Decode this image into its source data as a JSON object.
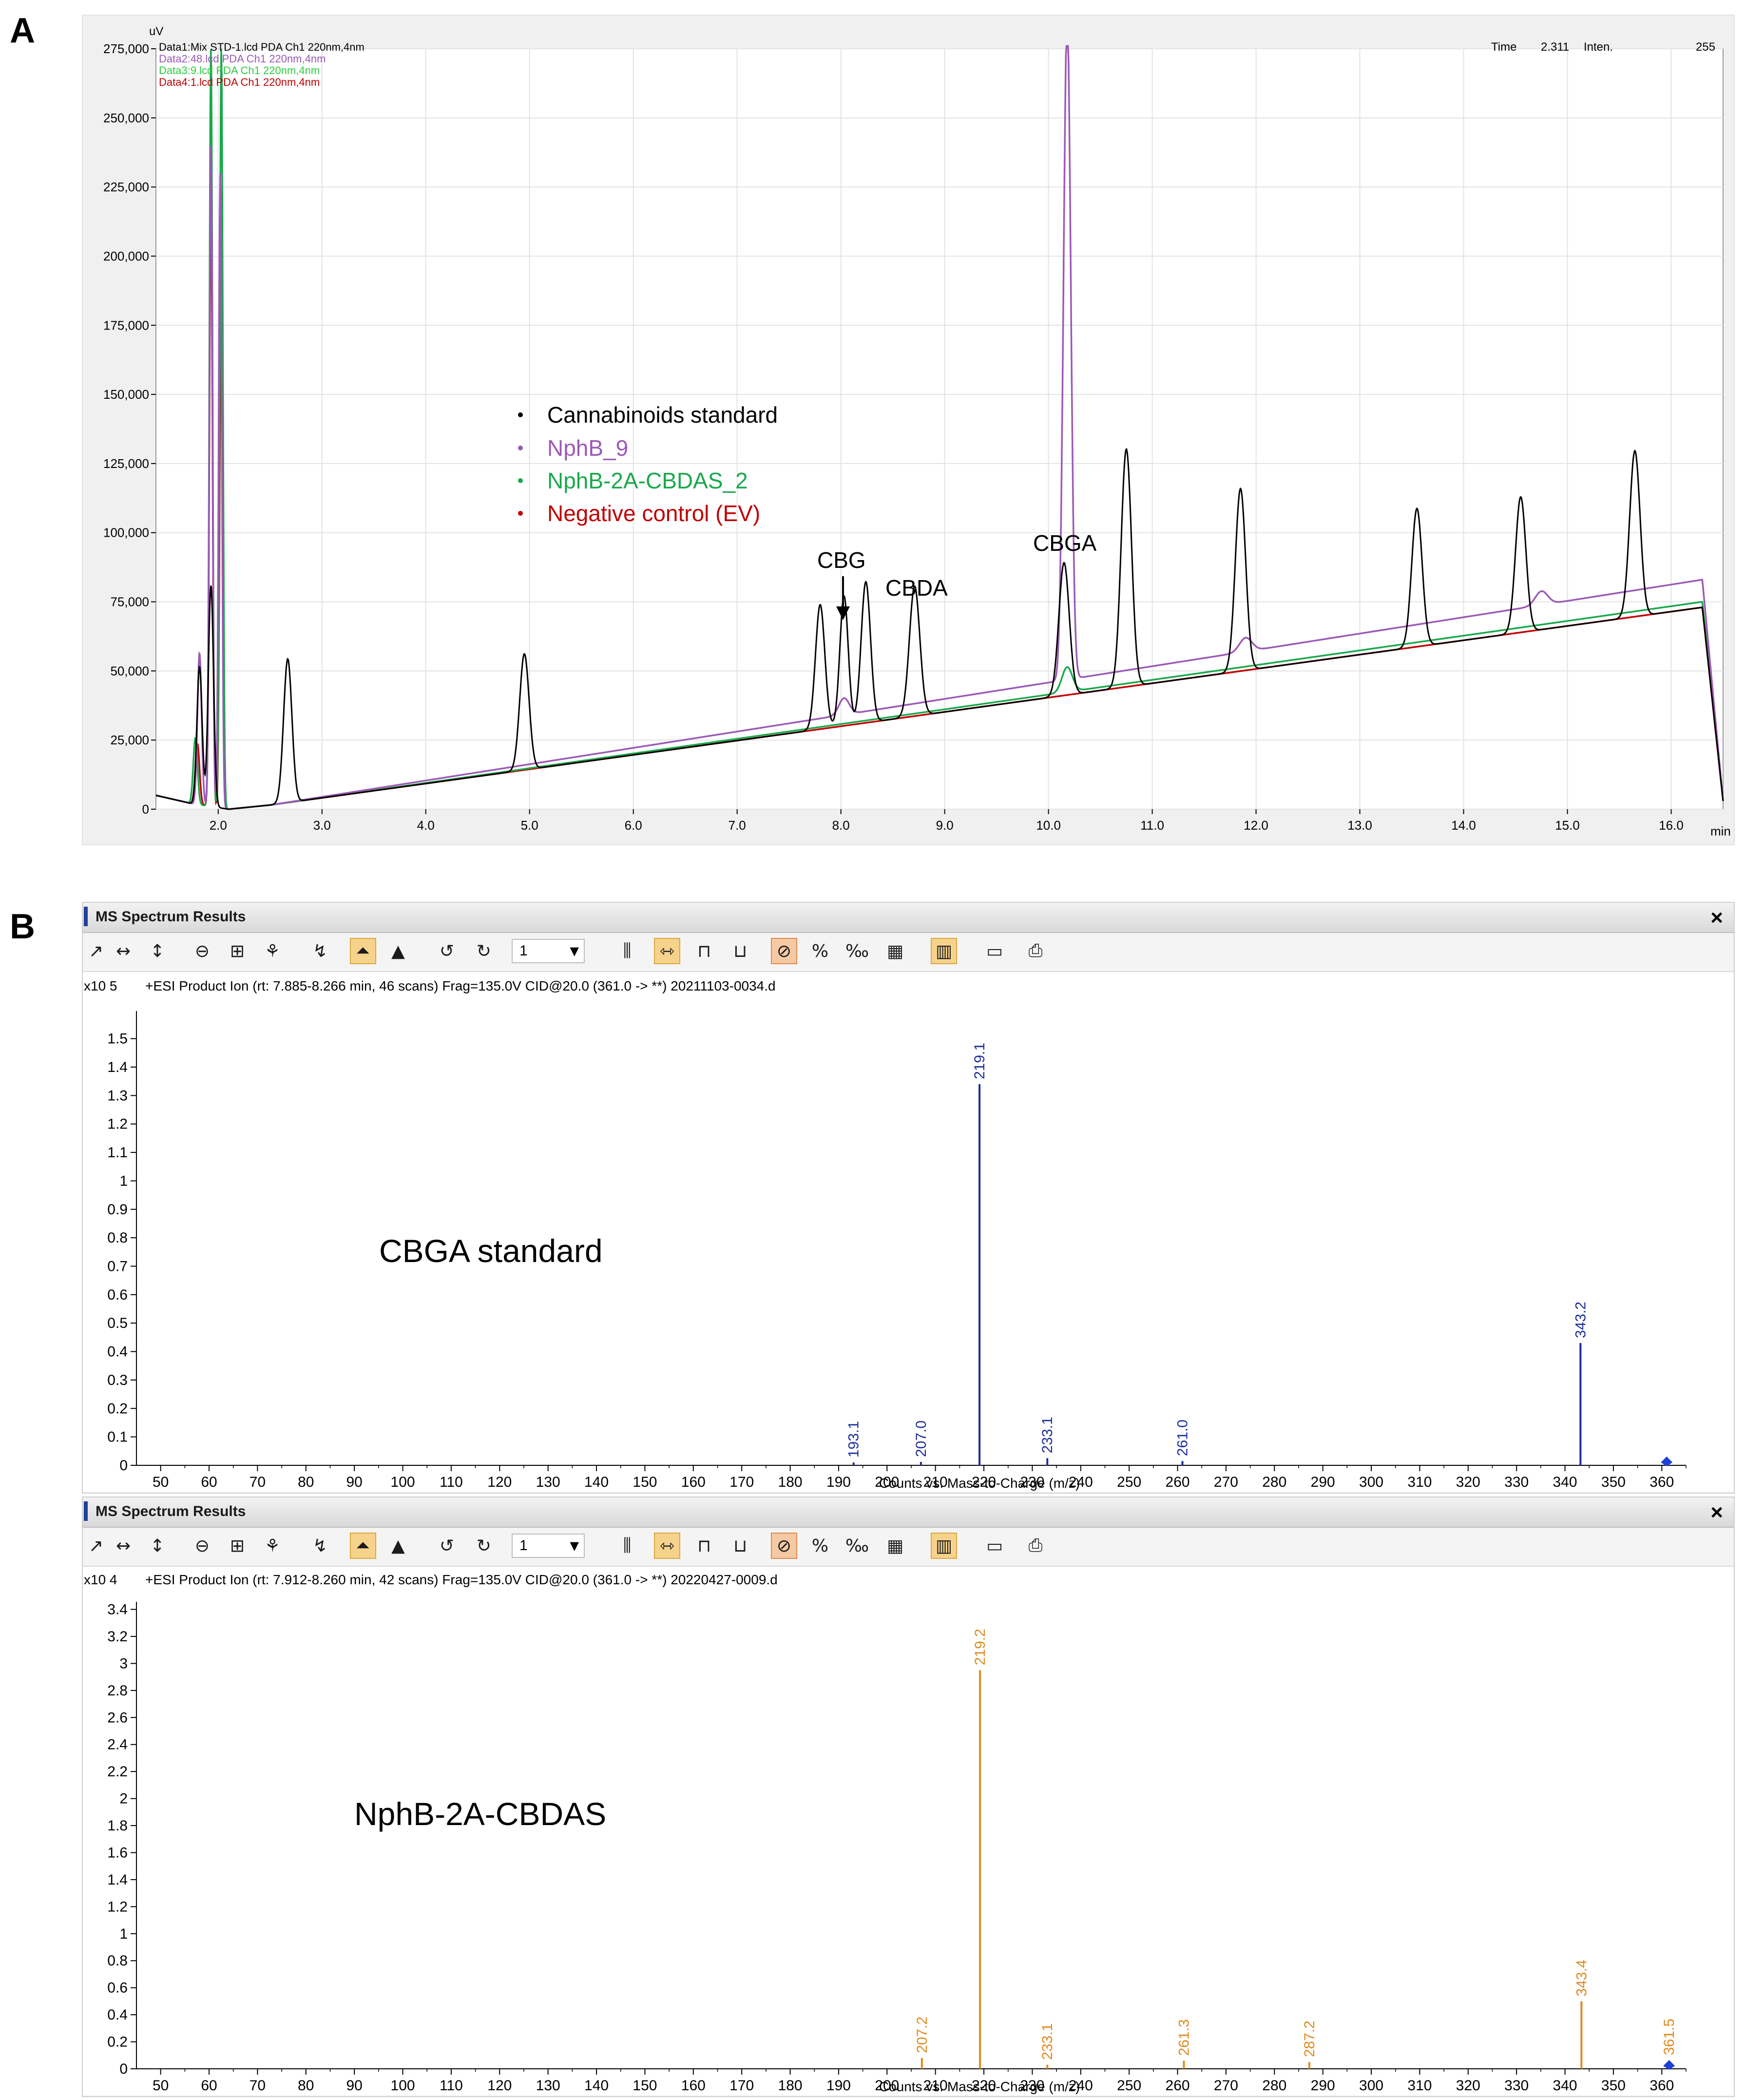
{
  "panel_labels": {
    "a": "A",
    "b": "B"
  },
  "chromatogram": {
    "y_unit": "uV",
    "x_unit": "min",
    "header": {
      "data_lines": [
        "Data1:Mix STD-1.lcd PDA Ch1 220nm,4nm",
        "Data2:48.lcd PDA Ch1 220nm,4nm",
        "Data3:9.lcd PDA Ch1 220nm,4nm",
        "Data4:1.lcd PDA Ch1 220nm,4nm"
      ],
      "time_label": "Time",
      "time_value": "2.311",
      "inten_label": "Inten.",
      "inten_value": "255"
    },
    "legend": [
      {
        "label": "Cannabinoids standard",
        "color": "#000000"
      },
      {
        "label": "NphB_9",
        "color": "#9b59b6"
      },
      {
        "label": "NphB-2A-CBDAS_2",
        "color": "#19a84b"
      },
      {
        "label": "Negative control (EV)",
        "color": "#c00000"
      }
    ],
    "annotations": {
      "cbg": "CBG",
      "cbda": "CBDA",
      "cbga": "CBGA"
    },
    "y_ticks": [
      "0",
      "25,000",
      "50,000",
      "75,000",
      "100,000",
      "125,000",
      "150,000",
      "175,000",
      "200,000",
      "225,000",
      "250,000",
      "275,000"
    ],
    "x_ticks": [
      "2.0",
      "3.0",
      "4.0",
      "5.0",
      "6.0",
      "7.0",
      "8.0",
      "9.0",
      "10.0",
      "11.0",
      "12.0",
      "13.0",
      "14.0",
      "15.0",
      "16.0"
    ]
  },
  "chart_data": [
    {
      "type": "line",
      "title": "",
      "xlabel": "min",
      "ylabel": "uV",
      "xlim": [
        1.4,
        16.5
      ],
      "ylim": [
        0,
        275000
      ],
      "grid": true,
      "series": [
        {
          "name": "Cannabinoids standard",
          "color": "#000000",
          "baseline": [
            [
              1.4,
              5000
            ],
            [
              1.75,
              2000
            ],
            [
              2.1,
              0
            ],
            [
              2.5,
              1500
            ],
            [
              16.3,
              73000
            ],
            [
              16.5,
              3000
            ]
          ],
          "peaks": [
            [
              1.82,
              50000,
              0.025
            ],
            [
              1.93,
              80000,
              0.025
            ],
            [
              2.67,
              52000,
              0.04
            ],
            [
              4.95,
              42000,
              0.045
            ],
            [
              7.8,
              45000,
              0.045
            ],
            [
              8.03,
              47000,
              0.04
            ],
            [
              8.24,
              51000,
              0.045
            ],
            [
              8.71,
              47000,
              0.05
            ],
            [
              10.15,
              48000,
              0.05
            ],
            [
              10.75,
              86000,
              0.05
            ],
            [
              11.85,
              66000,
              0.05
            ],
            [
              13.55,
              50000,
              0.05
            ],
            [
              14.55,
              49000,
              0.05
            ],
            [
              15.65,
              60000,
              0.05
            ]
          ]
        },
        {
          "name": "NphB_9",
          "color": "#9b59b6",
          "baseline": [
            [
              1.4,
              5000
            ],
            [
              1.75,
              2000
            ],
            [
              2.1,
              0
            ],
            [
              2.5,
              1500
            ],
            [
              16.3,
              83000
            ],
            [
              16.5,
              3000
            ]
          ],
          "peaks": [
            [
              1.82,
              55000,
              0.02
            ],
            [
              1.93,
              240000,
              0.015
            ],
            [
              2.02,
              230000,
              0.015
            ],
            [
              8.03,
              6000,
              0.05
            ],
            [
              10.18,
              240000,
              0.035
            ],
            [
              11.9,
              5000,
              0.06
            ],
            [
              14.75,
              5000,
              0.06
            ]
          ]
        },
        {
          "name": "NphB-2A-CBDAS_2",
          "color": "#19a84b",
          "baseline": [
            [
              1.4,
              5000
            ],
            [
              1.75,
              2000
            ],
            [
              2.1,
              0
            ],
            [
              2.5,
              1500
            ],
            [
              16.3,
              75000
            ],
            [
              16.5,
              3000
            ]
          ],
          "peaks": [
            [
              1.78,
              24000,
              0.02
            ],
            [
              1.93,
              275000,
              0.015
            ],
            [
              2.03,
              275000,
              0.015
            ],
            [
              10.18,
              9000,
              0.05
            ]
          ]
        },
        {
          "name": "Negative control (EV)",
          "color": "#c00000",
          "baseline": [
            [
              1.4,
              5000
            ],
            [
              1.75,
              2000
            ],
            [
              2.1,
              0
            ],
            [
              2.5,
              1500
            ],
            [
              16.3,
              73000
            ],
            [
              16.5,
              3000
            ]
          ],
          "peaks": [
            [
              1.8,
              22000,
              0.02
            ],
            [
              1.93,
              220000,
              0.015
            ],
            [
              2.03,
              200000,
              0.015
            ]
          ]
        }
      ]
    },
    {
      "type": "bar",
      "title": "CBGA standard",
      "xlabel": "Counts vs. Mass-to-Charge (m/z)",
      "ylabel": "x10 5",
      "xlim": [
        45,
        365
      ],
      "ylim": [
        0,
        1.58
      ],
      "color": "#1c2d9c",
      "peaks": [
        {
          "mz": 193.1,
          "value": 0.01,
          "label": "193.1"
        },
        {
          "mz": 207.0,
          "value": 0.012,
          "label": "207.0"
        },
        {
          "mz": 219.1,
          "value": 1.34,
          "label": "219.1"
        },
        {
          "mz": 233.1,
          "value": 0.025,
          "label": "233.1"
        },
        {
          "mz": 261.0,
          "value": 0.015,
          "label": "261.0"
        },
        {
          "mz": 343.2,
          "value": 0.43,
          "label": "343.2"
        }
      ],
      "marker_mz": 361.0
    },
    {
      "type": "bar",
      "title": "NphB-2A-CBDAS",
      "xlabel": "Counts vs. Mass-to-Charge (m/z)",
      "ylabel": "x10 4",
      "xlim": [
        45,
        365
      ],
      "ylim": [
        0,
        3.42
      ],
      "color": "#e08a1e",
      "peaks": [
        {
          "mz": 207.2,
          "value": 0.08,
          "label": "207.2"
        },
        {
          "mz": 219.2,
          "value": 2.95,
          "label": "219.2"
        },
        {
          "mz": 233.1,
          "value": 0.03,
          "label": "233.1"
        },
        {
          "mz": 261.3,
          "value": 0.06,
          "label": "261.3"
        },
        {
          "mz": 287.2,
          "value": 0.05,
          "label": "287.2"
        },
        {
          "mz": 343.4,
          "value": 0.5,
          "label": "343.4"
        }
      ],
      "marker_mz": 361.5,
      "marker_label": "361.5"
    }
  ],
  "ms_windows": [
    {
      "title": "MS Spectrum Results",
      "close_symbol": "×",
      "zoom_value": "1",
      "header_text": "+ESI Product Ion (rt: 7.885-8.266 min, 46 scans) Frag=135.0V CID@20.0 (361.0 -> **) 20211103-0034.d",
      "exponent_label": "x10 5",
      "y_ticks": [
        "0",
        "0.1",
        "0.2",
        "0.3",
        "0.4",
        "0.5",
        "0.6",
        "0.7",
        "0.8",
        "0.9",
        "1",
        "1.1",
        "1.2",
        "1.3",
        "1.4",
        "1.5"
      ],
      "x_ticks": [
        "50",
        "60",
        "70",
        "80",
        "90",
        "100",
        "110",
        "120",
        "130",
        "140",
        "150",
        "160",
        "170",
        "180",
        "190",
        "200",
        "210",
        "220",
        "230",
        "240",
        "250",
        "260",
        "270",
        "280",
        "290",
        "300",
        "310",
        "320",
        "330",
        "340",
        "350",
        "360"
      ],
      "x_axis_label": "Counts vs. Mass-to-Charge (m/z)",
      "sample_label": "CBGA standard"
    },
    {
      "title": "MS Spectrum Results",
      "close_symbol": "×",
      "zoom_value": "1",
      "header_text": "+ESI Product Ion (rt: 7.912-8.260 min, 42 scans) Frag=135.0V CID@20.0 (361.0 -> **) 20220427-0009.d",
      "exponent_label": "x10 4",
      "y_ticks": [
        "0",
        "0.2",
        "0.4",
        "0.6",
        "0.8",
        "1",
        "1.2",
        "1.4",
        "1.6",
        "1.8",
        "2",
        "2.2",
        "2.4",
        "2.6",
        "2.8",
        "3",
        "3.2",
        "3.4"
      ],
      "x_ticks": [
        "50",
        "60",
        "70",
        "80",
        "90",
        "100",
        "110",
        "120",
        "130",
        "140",
        "150",
        "160",
        "170",
        "180",
        "190",
        "200",
        "210",
        "220",
        "230",
        "240",
        "250",
        "260",
        "270",
        "280",
        "290",
        "300",
        "310",
        "320",
        "330",
        "340",
        "350",
        "360"
      ],
      "x_axis_label": "Counts vs. Mass-to-Charge (m/z)",
      "sample_label": "NphB-2A-CBDAS"
    }
  ]
}
